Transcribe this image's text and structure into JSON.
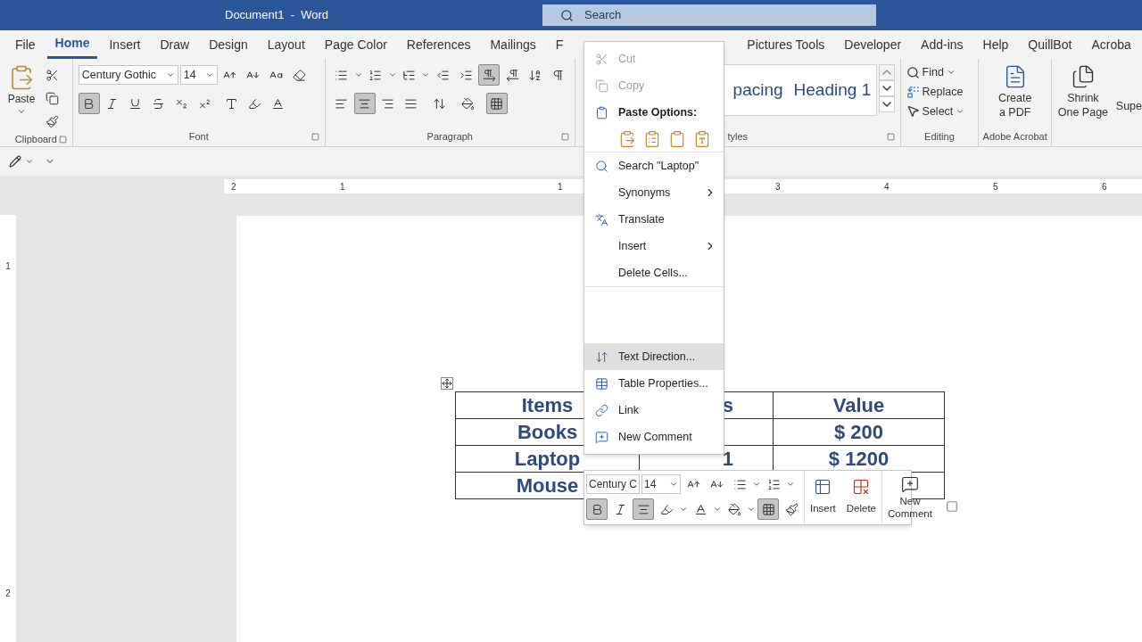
{
  "window": {
    "title": "Document1  -  Word",
    "search_placeholder": "Search"
  },
  "tabs": [
    {
      "label": "File",
      "selected": false
    },
    {
      "label": "Home",
      "selected": true
    },
    {
      "label": "Insert",
      "selected": false
    },
    {
      "label": "Draw",
      "selected": false
    },
    {
      "label": "Design",
      "selected": false
    },
    {
      "label": "Layout",
      "selected": false
    },
    {
      "label": "Page Color",
      "selected": false
    },
    {
      "label": "References",
      "selected": false
    },
    {
      "label": "Mailings",
      "selected": false
    },
    {
      "label": "F",
      "selected": false
    }
  ],
  "tabs_right": [
    {
      "label": "Pictures Tools",
      "selected": false
    },
    {
      "label": "Developer",
      "selected": false
    },
    {
      "label": "Add-ins",
      "selected": false
    },
    {
      "label": "Help",
      "selected": false
    },
    {
      "label": "QuillBot",
      "selected": false
    },
    {
      "label": "Acroba",
      "selected": false
    }
  ],
  "ribbon": {
    "clipboard": {
      "paste": "Paste",
      "label": "Clipboard"
    },
    "font": {
      "name": "Century Gothic",
      "size": "14",
      "label": "Font",
      "toggles": [
        {
          "kind": "bold",
          "pressed": true
        },
        {
          "kind": "italic",
          "pressed": false
        },
        {
          "kind": "underline",
          "pressed": false
        },
        {
          "kind": "strikethrough",
          "pressed": false
        },
        {
          "kind": "subscript",
          "pressed": false
        },
        {
          "kind": "superscript",
          "pressed": false
        }
      ]
    },
    "paragraph": {
      "label": "Paragraph",
      "direction": [
        {
          "kind": "ltr",
          "pressed": true
        },
        {
          "kind": "rtl",
          "pressed": false
        }
      ],
      "align": [
        {
          "kind": "left",
          "pressed": false
        },
        {
          "kind": "center",
          "pressed": true
        },
        {
          "kind": "right",
          "pressed": false
        },
        {
          "kind": "justify",
          "pressed": false
        }
      ],
      "borders_pressed": true
    },
    "styles": {
      "items": [
        "pacing",
        "Heading 1"
      ],
      "label": "tyles"
    },
    "editing": {
      "find": "Find",
      "replace": "Replace",
      "select": "Select",
      "label": "Editing"
    },
    "acrobat": {
      "button": "Create\na PDF",
      "label": "Adobe Acrobat"
    },
    "shrink": {
      "button": "Shrink\nOne Page"
    },
    "super": {
      "button": "Supe"
    }
  },
  "ruler": {
    "left_labels": [
      "2",
      "1"
    ],
    "middle_labels": [
      "1"
    ],
    "right_labels": [
      "3",
      "4",
      "5",
      "6"
    ],
    "vertical_labels": [
      "1",
      "2"
    ]
  },
  "table": {
    "rows": [
      {
        "cells": [
          "Items",
          "s",
          "Value"
        ]
      },
      {
        "cells": [
          "Books",
          null,
          "$ 200"
        ]
      },
      {
        "cells": [
          "Laptop",
          "1",
          "$ 1200"
        ]
      },
      {
        "cells": [
          "Mouse",
          null,
          null
        ]
      }
    ]
  },
  "context_menu": {
    "top_items": [
      {
        "kind": "cut",
        "label": "Cut",
        "disabled": true,
        "submenu": false,
        "selected": false
      },
      {
        "kind": "copy",
        "label": "Copy",
        "disabled": true,
        "submenu": false,
        "selected": false
      },
      {
        "kind": "paste",
        "label": "Paste Options:",
        "disabled": false,
        "submenu": false,
        "selected": false
      },
      {
        "kind": "search",
        "label": "Search \"Laptop\"",
        "disabled": false,
        "submenu": false,
        "selected": false
      },
      {
        "kind": "synonyms",
        "label": "Synonyms",
        "disabled": false,
        "submenu": true,
        "selected": false
      },
      {
        "kind": "translate",
        "label": "Translate",
        "disabled": false,
        "submenu": false,
        "selected": false
      },
      {
        "kind": "insert",
        "label": "Insert",
        "disabled": false,
        "submenu": true,
        "selected": false
      },
      {
        "kind": "delete",
        "label": "Delete Cells...",
        "disabled": false,
        "submenu": false,
        "selected": false
      }
    ],
    "bottom_items": [
      {
        "kind": "text-direction",
        "label": "Text Direction...",
        "disabled": false,
        "submenu": false,
        "selected": true
      },
      {
        "kind": "table-properties",
        "label": "Table Properties...",
        "disabled": false,
        "submenu": false,
        "selected": false
      },
      {
        "kind": "link",
        "label": "Link",
        "disabled": false,
        "submenu": false,
        "selected": false
      },
      {
        "kind": "comment",
        "label": "New Comment",
        "disabled": false,
        "submenu": false,
        "selected": false
      }
    ]
  },
  "mini_toolbar": {
    "font": "Century C",
    "size": "14",
    "bold_pressed": true,
    "center_pressed": true,
    "borders_pressed": true,
    "insert": "Insert",
    "delete": "Delete",
    "comment": "New\nComment"
  }
}
